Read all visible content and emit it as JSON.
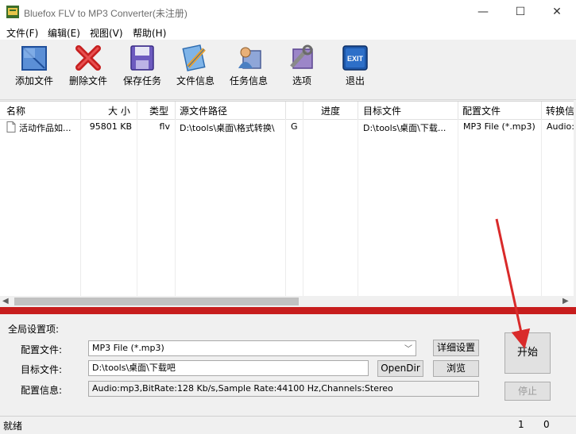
{
  "window": {
    "title": "Bluefox FLV to MP3 Converter(未注册)",
    "minimize": "—",
    "maximize": "☐",
    "close": "✕"
  },
  "menu": [
    "文件(F)",
    "编辑(E)",
    "视图(V)",
    "帮助(H)"
  ],
  "toolbar": {
    "add": "添加文件",
    "delete": "删除文件",
    "save_task": "保存任务",
    "file_info": "文件信息",
    "task_info": "任务信息",
    "options": "选项",
    "exit": "退出",
    "exit_icon_text": "EXIT"
  },
  "table": {
    "headers": [
      "名称",
      "大 小",
      "类型",
      "源文件路径",
      "进度",
      "目标文件",
      "配置文件",
      "转换信"
    ],
    "rows": [
      {
        "name": "活动作品如...",
        "size": "95801 KB",
        "type": "flv",
        "source": "D:\\tools\\桌面\\格式转换\\",
        "extra": "G",
        "progress": "",
        "target": "D:\\tools\\桌面\\下载...",
        "profile": "MP3 File (*.mp3)",
        "info": "Audio:r"
      }
    ]
  },
  "settings": {
    "section_label": "全局设置项:",
    "profile_label": "配置文件:",
    "profile_value": "MP3 File (*.mp3)",
    "detail_button": "详细设置",
    "target_label": "目标文件:",
    "target_value": "D:\\tools\\桌面\\下载吧",
    "opendir_button": "OpenDir",
    "browse_button": "浏览",
    "info_label": "配置信息:",
    "info_value": "Audio:mp3,BitRate:128 Kb/s,Sample Rate:44100 Hz,Channels:Stereo",
    "start_button": "开始",
    "stop_button": "停止"
  },
  "status": {
    "text": "就绪",
    "count1": "1",
    "count2": "0"
  },
  "colors": {
    "accent_red": "#c71d1d",
    "arrow": "#d92a2a"
  }
}
